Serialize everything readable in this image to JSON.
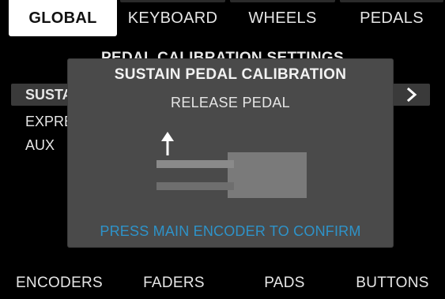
{
  "top_tabs": {
    "global": "GLOBAL",
    "keyboard": "KEYBOARD",
    "wheels": "WHEELS",
    "pedals": "PEDALS",
    "active": "global"
  },
  "page": {
    "title": "PEDAL CALIBRATION SETTINGS",
    "items": [
      {
        "label": "SUSTAIN",
        "selected": true
      },
      {
        "label": "EXPRESSION",
        "selected": false
      },
      {
        "label": "AUX",
        "selected": false
      }
    ],
    "next_icon": "chevron-right-icon"
  },
  "modal": {
    "title": "SUSTAIN PEDAL CALIBRATION",
    "message": "RELEASE PEDAL",
    "graphic_icon": "pedal-release-icon",
    "footer": "PRESS MAIN ENCODER TO CONFIRM",
    "footer_color": "#2e93c9"
  },
  "bottom_tabs": {
    "encoders": "ENCODERS",
    "faders": "FADERS",
    "pads": "PADS",
    "buttons": "BUTTONS"
  }
}
